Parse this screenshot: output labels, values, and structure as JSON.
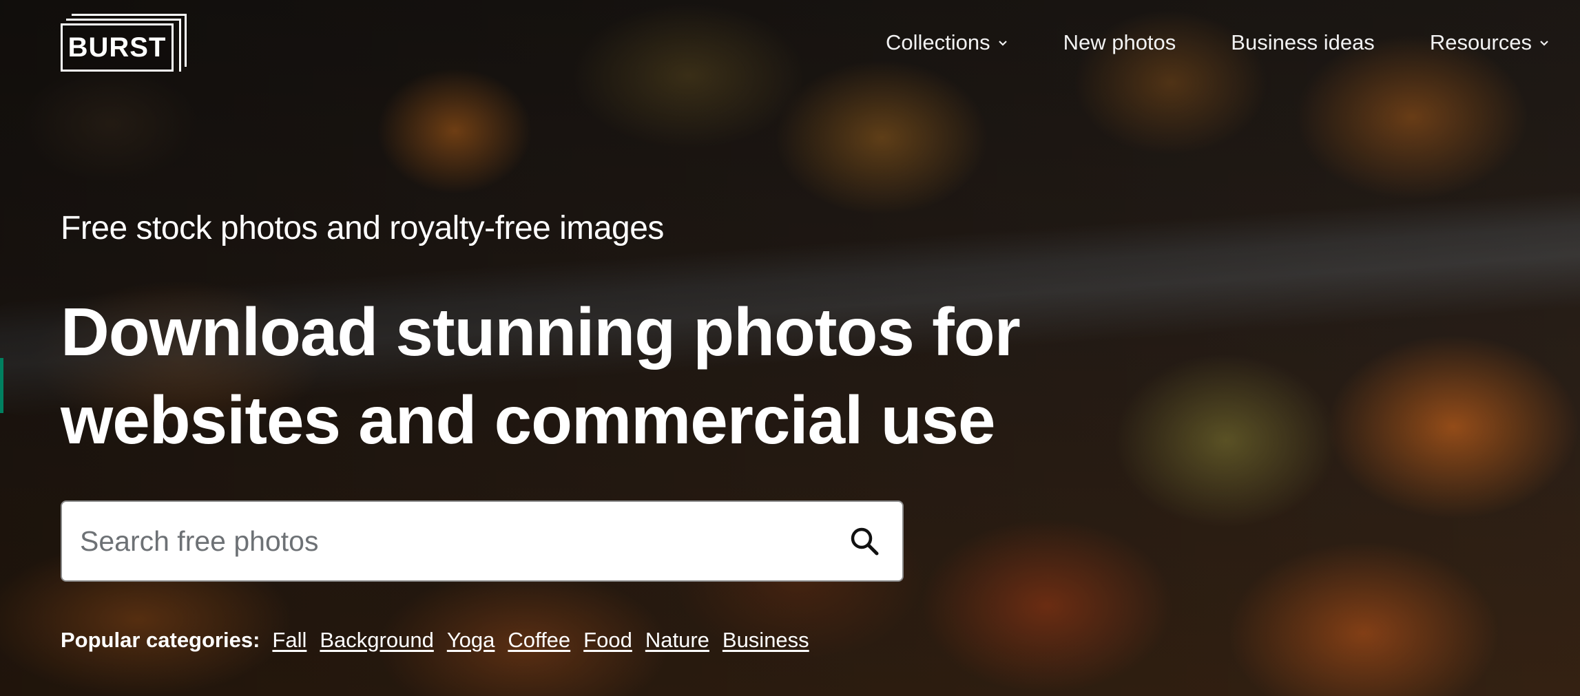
{
  "brand": {
    "logo_text": "BURST"
  },
  "nav": {
    "items": [
      {
        "label": "Collections",
        "dropdown": true
      },
      {
        "label": "New photos",
        "dropdown": false
      },
      {
        "label": "Business ideas",
        "dropdown": false
      },
      {
        "label": "Resources",
        "dropdown": true
      }
    ]
  },
  "hero": {
    "tagline": "Free stock photos and royalty-free images",
    "headline_line1": "Download stunning photos for",
    "headline_line2": "websites and commercial use"
  },
  "search": {
    "placeholder": "Search free photos",
    "value": "",
    "icon": "search-icon"
  },
  "popular": {
    "label": "Popular categories:",
    "categories": [
      "Fall",
      "Background",
      "Yoga",
      "Coffee",
      "Food",
      "Nature",
      "Business"
    ]
  },
  "colors": {
    "accent": "#008060",
    "text": "#ffffff",
    "search_bg": "#ffffff"
  }
}
